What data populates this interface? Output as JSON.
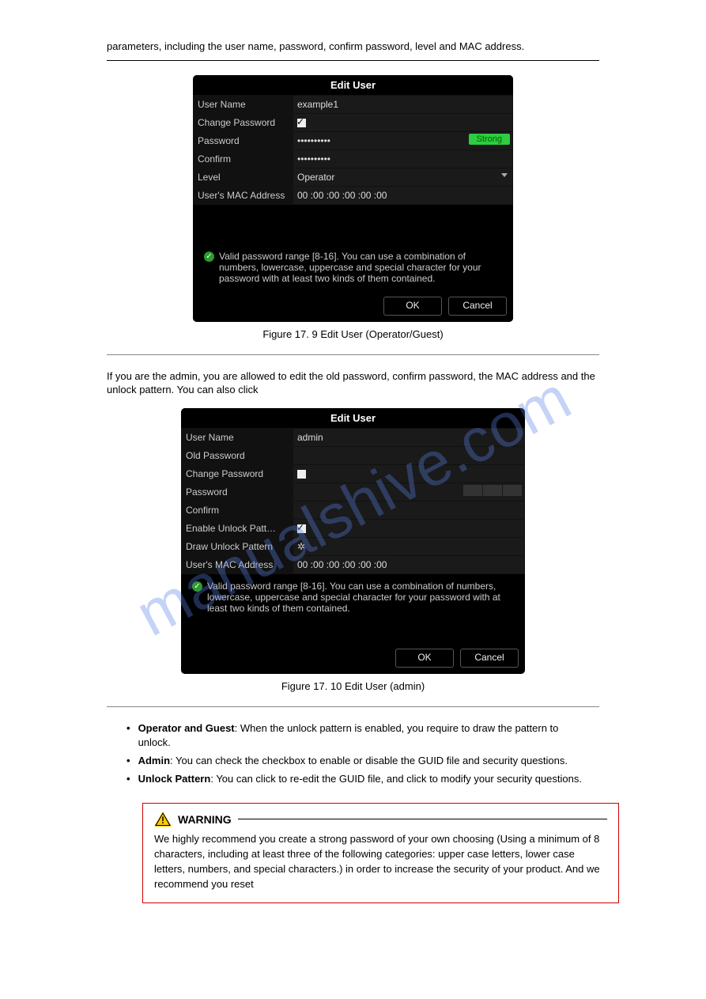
{
  "watermark": "manualshive.com",
  "text_intro": "parameters, including the user name, password, confirm password, level and MAC address.",
  "dialog1": {
    "title": "Edit User",
    "rows": {
      "username_label": "User Name",
      "username_value": "example1",
      "change_pw_label": "Change Password",
      "change_pw_checked": true,
      "password_label": "Password",
      "password_value": "••••••••••",
      "strength_label": "Strong",
      "confirm_label": "Confirm",
      "confirm_value": "••••••••••",
      "level_label": "Level",
      "level_value": "Operator",
      "mac_label": "User's MAC Address",
      "mac_value": "00   :00   :00   :00   :00   :00"
    },
    "hint": "Valid password range [8-16]. You can use a combination of numbers, lowercase, uppercase and special character for your password with at least two kinds of them contained.",
    "ok": "OK",
    "cancel": "Cancel"
  },
  "caption1": "Figure 17. 9 Edit User (Operator/Guest)",
  "dialog2": {
    "title": "Edit User",
    "rows": {
      "username_label": "User Name",
      "username_value": "admin",
      "oldpw_label": "Old Password",
      "change_pw_label": "Change Password",
      "change_pw_checked": false,
      "password_label": "Password",
      "confirm_label": "Confirm",
      "enable_pattern_label": "Enable Unlock Patt…",
      "enable_pattern_checked": true,
      "draw_pattern_label": "Draw Unlock Pattern",
      "mac_label": "User's MAC Address",
      "mac_value": "00   :00   :00   :00   :00   :00"
    },
    "hint": "Valid password range [8-16]. You can use a combination of numbers, lowercase, uppercase and special character for your password with at least two kinds of them contained.",
    "ok": "OK",
    "cancel": "Cancel"
  },
  "caption2": "Figure 17. 10 Edit User (admin)",
  "admin_intro": "If you are the admin, you are allowed to edit the old password, confirm password, the MAC address and the unlock pattern. You can also click",
  "admin_intro2": "to modify your security questions.",
  "bullets": {
    "b1_lead": "Operator and Guest",
    "b1_text": "When the unlock pattern is enabled, you require to draw the pattern to unlock.",
    "b2_lead": "Admin",
    "b2_text": "You can check the checkbox to enable or disable the GUID file and security questions.",
    "b3_lead": "Unlock Pattern",
    "b3_text": "You can click to re-edit the GUID file, and click to modify your security questions."
  },
  "warning": {
    "title": "WARNING",
    "body": "We highly recommend you create a strong password of your own choosing (Using a minimum of 8 characters, including at least three of the following categories: upper case letters, lower case letters, numbers, and special characters.) in order to increase the security of your product. And we recommend you reset"
  }
}
